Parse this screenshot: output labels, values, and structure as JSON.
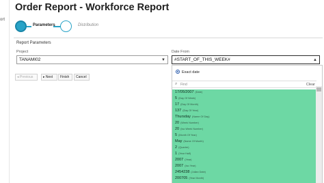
{
  "page": {
    "title": "Order Report - Workforce Report",
    "left_cut_text": "ort"
  },
  "wizard": {
    "steps": [
      {
        "label": "Parameters"
      },
      {
        "label": "Distribution"
      }
    ]
  },
  "section": {
    "title": "Report Parameters"
  },
  "project": {
    "label": "Project",
    "value": "TANAMI02"
  },
  "date_from": {
    "label": "Date From",
    "value": "#START_OF_THIS_WEEK#"
  },
  "buttons": {
    "previous": "Previous",
    "next": "Next",
    "finish": "Finish",
    "cancel": "Cancel"
  },
  "dropdown": {
    "exact_date": "Exact date",
    "find_placeholder": "Find",
    "clear": "Clear",
    "items": [
      {
        "value": "17/05/2007",
        "hint": "(Date)"
      },
      {
        "value": "5",
        "hint": "(Day Of Week)"
      },
      {
        "value": "17",
        "hint": "(Day Of Month)"
      },
      {
        "value": "137",
        "hint": "(Day Of Year)"
      },
      {
        "value": "Thursday",
        "hint": "(Name Of Day)"
      },
      {
        "value": "20",
        "hint": "(Week Number)"
      },
      {
        "value": "20",
        "hint": "(Iso Week Number)"
      },
      {
        "value": "5",
        "hint": "(Month Of Year)"
      },
      {
        "value": "May",
        "hint": "(Name Of Month)"
      },
      {
        "value": "2",
        "hint": "(Quarter)"
      },
      {
        "value": "1",
        "hint": "(Year Half)"
      },
      {
        "value": "2007",
        "hint": "(Year)"
      },
      {
        "value": "2007",
        "hint": "(Iso Year)"
      },
      {
        "value": "2454238",
        "hint": "(Julian Date)"
      },
      {
        "value": "200705",
        "hint": "(Year Month)"
      }
    ]
  },
  "colors": {
    "accent": "#29a3c7",
    "list_bg": "#6dd8a4"
  }
}
